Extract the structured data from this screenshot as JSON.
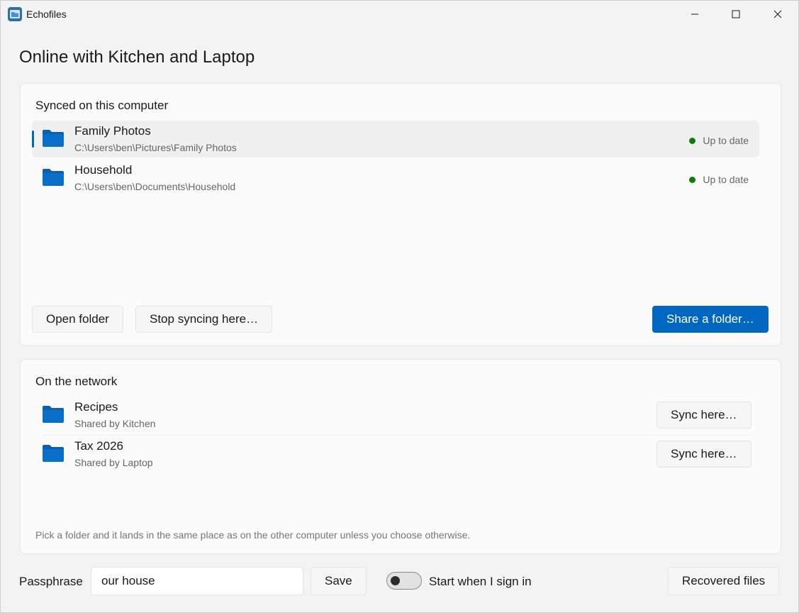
{
  "window": {
    "app_title": "Echofiles",
    "controls": {
      "minimize": "minimize-icon",
      "maximize": "maximize-icon",
      "close": "close-icon"
    }
  },
  "page": {
    "title": "Online with Kitchen and Laptop"
  },
  "synced": {
    "title": "Synced on this computer",
    "folders": [
      {
        "name": "Family Photos",
        "path": "C:\\Users\\ben\\Pictures\\Family Photos",
        "status": "Up to date",
        "selected": true
      },
      {
        "name": "Household",
        "path": "C:\\Users\\ben\\Documents\\Household",
        "status": "Up to date",
        "selected": false
      }
    ],
    "buttons": {
      "open": "Open folder",
      "stop": "Stop syncing here…",
      "share": "Share a folder…"
    }
  },
  "network": {
    "title": "On the network",
    "folders": [
      {
        "name": "Recipes",
        "shared_by": "Shared by Kitchen",
        "action": "Sync here…"
      },
      {
        "name": "Tax 2026",
        "shared_by": "Shared by Laptop",
        "action": "Sync here…"
      }
    ],
    "hint": "Pick a folder and it lands in the same place as on the other computer unless you choose otherwise."
  },
  "footer": {
    "passphrase_label": "Passphrase",
    "passphrase_value": "our house",
    "save": "Save",
    "start_toggle_label": "Start when I sign in",
    "start_toggle_on": false,
    "recovered": "Recovered files"
  },
  "colors": {
    "accent": "#0067c0",
    "status_ok": "#0f7b0f",
    "folder": "#0a6fc9"
  }
}
